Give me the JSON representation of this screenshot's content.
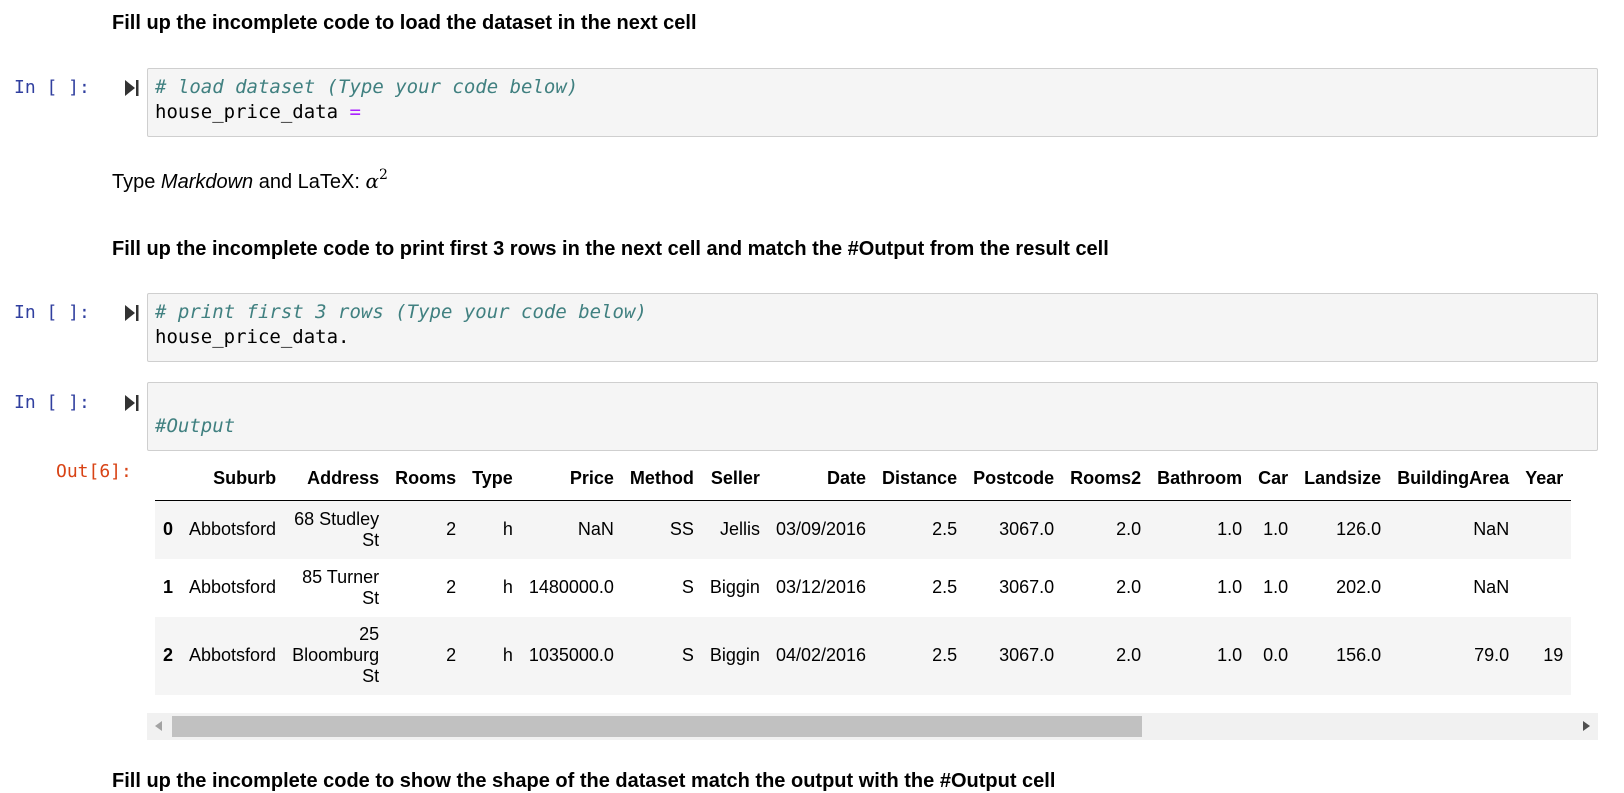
{
  "cells": {
    "md1": {
      "text": "Fill up the incomplete code to load the dataset in the next cell"
    },
    "code1": {
      "prompt": "In [ ]:",
      "comment": "# load dataset (Type your code below)",
      "code_prefix": "house_price_data ",
      "code_op": "="
    },
    "md2": {
      "text_before": "Type ",
      "text_italic": "Markdown",
      "text_after": " and LaTeX: ",
      "math_var": "α",
      "math_sup": "2"
    },
    "md3": {
      "text": "Fill up the incomplete code to print first 3 rows in the next cell and match the #Output from the result cell"
    },
    "code2": {
      "prompt": "In [ ]:",
      "comment": "# print first 3 rows (Type your code below)",
      "code": "house_price_data."
    },
    "code3": {
      "prompt": "In [ ]:",
      "line1": "",
      "comment": "#Output"
    },
    "output": {
      "prompt": "Out[6]:",
      "columns": [
        "Suburb",
        "Address",
        "Rooms",
        "Type",
        "Price",
        "Method",
        "Seller",
        "Date",
        "Distance",
        "Postcode",
        "Rooms2",
        "Bathroom",
        "Car",
        "Landsize",
        "BuildingArea",
        "Year"
      ],
      "rows": [
        {
          "index": "0",
          "cells": [
            "Abbotsford",
            "68 Studley St",
            "2",
            "h",
            "NaN",
            "SS",
            "Jellis",
            "03/09/2016",
            "2.5",
            "3067.0",
            "2.0",
            "1.0",
            "1.0",
            "126.0",
            "NaN",
            ""
          ]
        },
        {
          "index": "1",
          "cells": [
            "Abbotsford",
            "85 Turner St",
            "2",
            "h",
            "1480000.0",
            "S",
            "Biggin",
            "03/12/2016",
            "2.5",
            "3067.0",
            "2.0",
            "1.0",
            "1.0",
            "202.0",
            "NaN",
            ""
          ]
        },
        {
          "index": "2",
          "cells": [
            "Abbotsford",
            "25 Bloomburg St",
            "2",
            "h",
            "1035000.0",
            "S",
            "Biggin",
            "04/02/2016",
            "2.5",
            "3067.0",
            "2.0",
            "1.0",
            "0.0",
            "156.0",
            "79.0",
            "19"
          ]
        }
      ],
      "address_lines": [
        [
          "68 Studley",
          "St"
        ],
        [
          "85 Turner",
          "St"
        ],
        [
          "25",
          "Bloomburg",
          "St"
        ]
      ]
    },
    "md4": {
      "text": "Fill up the incomplete code to show the shape of the dataset match the output with the #Output cell"
    }
  },
  "colors": {
    "in_prompt": "#303f9f",
    "out_prompt": "#d84315",
    "comment": "#408080",
    "operator": "#aa22ff"
  },
  "icons": {
    "run": "run-cell-icon"
  }
}
